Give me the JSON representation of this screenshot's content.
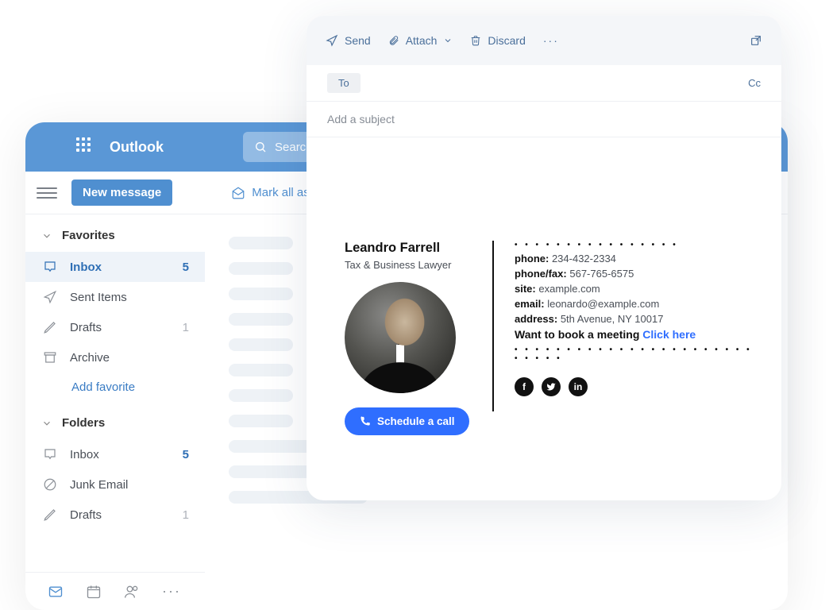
{
  "outlook": {
    "title": "Outlook",
    "search_placeholder": "Search",
    "new_message": "New message",
    "mark_all_read": "Mark all as re",
    "sections": {
      "favorites": "Favorites",
      "folders": "Folders",
      "add_favorite": "Add favorite"
    },
    "favorites_items": [
      {
        "label": "Inbox",
        "badge": "5"
      },
      {
        "label": "Sent Items"
      },
      {
        "label": "Drafts",
        "badge_muted": "1"
      },
      {
        "label": "Archive"
      }
    ],
    "folders_items": [
      {
        "label": "Inbox",
        "badge": "5"
      },
      {
        "label": "Junk Email"
      },
      {
        "label": "Drafts",
        "badge_muted": "1"
      }
    ]
  },
  "compose": {
    "toolbar": {
      "send": "Send",
      "attach": "Attach",
      "discard": "Discard"
    },
    "to_label": "To",
    "cc_label": "Cc",
    "subject_placeholder": "Add a subject"
  },
  "signature": {
    "name": "Leandro Farrell",
    "title": "Tax & Business Lawyer",
    "schedule_label": "Schedule a call",
    "phone_label": "phone:",
    "phone": "234-432-2334",
    "fax_label": "phone/fax:",
    "fax": "567-765-6575",
    "site_label": "site:",
    "site": "example.com",
    "email_label": "email:",
    "email": "leonardo@example.com",
    "address_label": "address:",
    "address": "5th Avenue, NY 10017",
    "book_text": "Want to book a meeting",
    "book_link": "Click here",
    "social": {
      "fb": "f",
      "tw": "",
      "in": "in"
    }
  }
}
